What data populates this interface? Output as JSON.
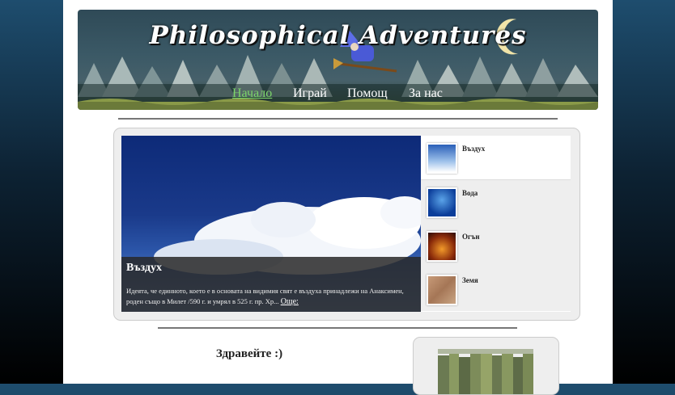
{
  "header": {
    "title": "Philosophical Adventures"
  },
  "nav": {
    "items": [
      {
        "label": "Начало",
        "active": true
      },
      {
        "label": "Играй",
        "active": false
      },
      {
        "label": "Помощ",
        "active": false
      },
      {
        "label": "За нас",
        "active": false
      }
    ]
  },
  "slider": {
    "caption_title": "Въздух",
    "caption_text": "Идеята, че единното, което е в основата на видимия свят е въздуха принадлежи на Анаксимен, роден също в Милет /590 г. и умрял в 525 г. пр. Хр...",
    "more_label": "Още:",
    "thumbs": [
      {
        "label": "Въздух",
        "icon": "air-thumbnail",
        "active": true
      },
      {
        "label": "Вода",
        "icon": "water-thumbnail",
        "active": false
      },
      {
        "label": "Огън",
        "icon": "fire-thumbnail",
        "active": false
      },
      {
        "label": "Земя",
        "icon": "earth-thumbnail",
        "active": false
      }
    ]
  },
  "content": {
    "greeting": "Здравейте :)"
  },
  "colors": {
    "nav_active": "#7cd66a",
    "background_top": "#1e4d6e",
    "page": "#ffffff"
  }
}
